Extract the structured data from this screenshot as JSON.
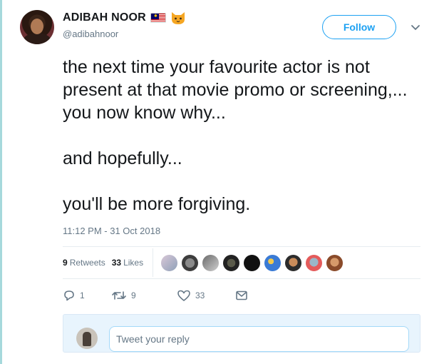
{
  "author": {
    "display_name": "ADIBAH NOOR",
    "handle": "@adibahnoor",
    "name_emojis": [
      "malaysia-flag-icon",
      "cat-face-icon"
    ],
    "avatar": "user-avatar"
  },
  "follow_label": "Follow",
  "tweet": {
    "text": "the next time your favourite actor is not present at that movie promo or screening,... you now know why...\n\nand hopefully...\n\nyou'll be more forgiving.",
    "timestamp": "11:12 PM - 31 Oct 2018"
  },
  "stats": {
    "retweets_count": "9",
    "retweets_label": "Retweets",
    "likes_count": "33",
    "likes_label": "Likes"
  },
  "actions": {
    "reply_count": "1",
    "retweet_count": "9",
    "like_count": "33"
  },
  "reply": {
    "placeholder": "Tweet your reply"
  },
  "colors": {
    "brand_blue": "#1da1f2",
    "text_gray": "#657786",
    "thread_line": "#a6d9dc",
    "reply_bg": "#e8f4fd"
  }
}
